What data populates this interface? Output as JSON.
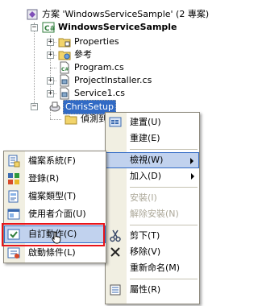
{
  "tree": {
    "solution_label": "方案 'WindowsServiceSample' (2 專案)",
    "project_label": "WindowsServiceSample",
    "items": [
      {
        "label": "Properties",
        "icon": "folder-properties-icon",
        "expander": "+"
      },
      {
        "label": "參考",
        "icon": "references-icon",
        "expander": "+"
      },
      {
        "label": "Program.cs",
        "icon": "csharp-file-icon",
        "expander": ""
      },
      {
        "label": "ProjectInstaller.cs",
        "icon": "component-file-icon",
        "expander": "+"
      },
      {
        "label": "Service1.cs",
        "icon": "component-file-icon",
        "expander": "+"
      }
    ],
    "setup_project_label": "ChrisSetup",
    "setup_child_label": "偵測到"
  },
  "context_menu": {
    "items": [
      {
        "label": "建置(U)",
        "icon": "build-icon",
        "enabled": true
      },
      {
        "label": "重建(E)",
        "icon": "",
        "enabled": true
      },
      {
        "separator": true
      },
      {
        "label": "檢視(W)",
        "icon": "",
        "enabled": true,
        "submenu": true,
        "highlighted": true
      },
      {
        "label": "加入(D)",
        "icon": "",
        "enabled": true,
        "submenu": true
      },
      {
        "separator": true
      },
      {
        "label": "安裝(I)",
        "icon": "",
        "enabled": false
      },
      {
        "label": "解除安裝(N)",
        "icon": "",
        "enabled": false
      },
      {
        "separator": true
      },
      {
        "label": "剪下(T)",
        "icon": "cut-icon",
        "enabled": true
      },
      {
        "label": "移除(V)",
        "icon": "delete-icon",
        "enabled": true
      },
      {
        "label": "重新命名(M)",
        "icon": "",
        "enabled": true
      },
      {
        "separator": true
      },
      {
        "label": "屬性(R)",
        "icon": "properties-icon",
        "enabled": true
      }
    ]
  },
  "view_submenu": {
    "items": [
      {
        "label": "檔案系統(F)",
        "icon": "file-system-editor-icon"
      },
      {
        "label": "登錄(R)",
        "icon": "registry-editor-icon"
      },
      {
        "label": "檔案類型(T)",
        "icon": "file-types-editor-icon"
      },
      {
        "label": "使用者介面(U)",
        "icon": "user-interface-editor-icon"
      },
      {
        "label": "自訂動作(C)",
        "icon": "custom-actions-editor-icon",
        "highlighted": true,
        "outlined": true
      },
      {
        "label": "啟動條件(L)",
        "icon": "launch-conditions-editor-icon"
      }
    ]
  },
  "colors": {
    "selection": "#316ac5",
    "menu_highlight": "#c1d2ee",
    "annotation_box": "#e8141a",
    "menu_gutter": "#f1efe2"
  }
}
